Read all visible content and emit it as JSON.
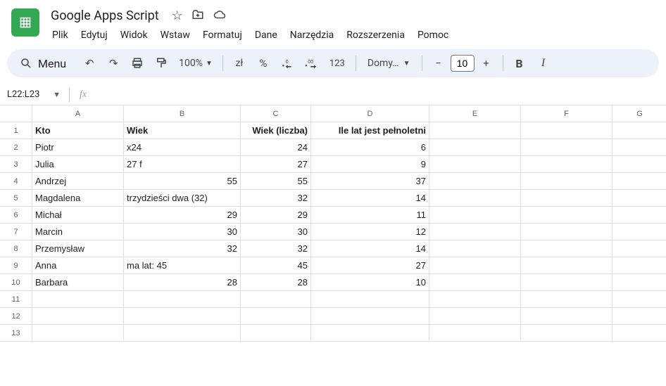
{
  "doc": {
    "title": "Google Apps Script"
  },
  "menubar": [
    "Plik",
    "Edytuj",
    "Widok",
    "Wstaw",
    "Formatuj",
    "Dane",
    "Narzędzia",
    "Rozszerzenia",
    "Pomoc"
  ],
  "toolbar": {
    "menu_label": "Menu",
    "zoom": "100%",
    "currency": "zł",
    "percent": "%",
    "font": "Domy…",
    "font_size": "10",
    "fmt_123": "123"
  },
  "namebox": {
    "ref": "L22:L23"
  },
  "columns": [
    "A",
    "B",
    "C",
    "D",
    "E",
    "F",
    "G"
  ],
  "headers": {
    "A": "Kto",
    "B": "Wiek",
    "C": "Wiek (liczba)",
    "D": "Ile lat jest pełnoletni"
  },
  "rows": [
    {
      "A": "Piotr",
      "B": "x24",
      "B_num": false,
      "C": "24",
      "D": "6"
    },
    {
      "A": "Julia",
      "B": "27   f",
      "B_num": false,
      "C": "27",
      "D": "9"
    },
    {
      "A": "Andrzej",
      "B": "55",
      "B_num": true,
      "C": "55",
      "D": "37"
    },
    {
      "A": "Magdalena",
      "B": "trzydzieści dwa (32)",
      "B_num": false,
      "C": "32",
      "D": "14"
    },
    {
      "A": "Michał",
      "B": "29",
      "B_num": true,
      "C": "29",
      "D": "11"
    },
    {
      "A": "Marcin",
      "B": "30",
      "B_num": true,
      "C": "30",
      "D": "12"
    },
    {
      "A": "Przemysław",
      "B": "32",
      "B_num": true,
      "C": "32",
      "D": "14"
    },
    {
      "A": "Anna",
      "B": "ma lat: 45",
      "B_num": false,
      "C": "45",
      "D": "27"
    },
    {
      "A": "Barbara",
      "B": "28",
      "B_num": true,
      "C": "28",
      "D": "10"
    }
  ],
  "empty_rows": 3
}
